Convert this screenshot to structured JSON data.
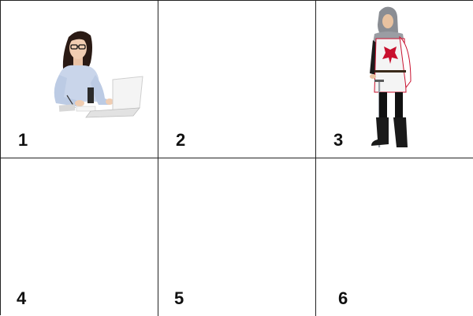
{
  "cells": [
    {
      "label": "1",
      "image": "woman-at-laptop"
    },
    {
      "label": "2",
      "image": ""
    },
    {
      "label": "3",
      "image": "crusader-knight"
    },
    {
      "label": "4",
      "image": ""
    },
    {
      "label": "5",
      "image": ""
    },
    {
      "label": "6",
      "image": ""
    }
  ],
  "colors": {
    "grid_line": "#222222",
    "cross_red": "#c8102e"
  }
}
